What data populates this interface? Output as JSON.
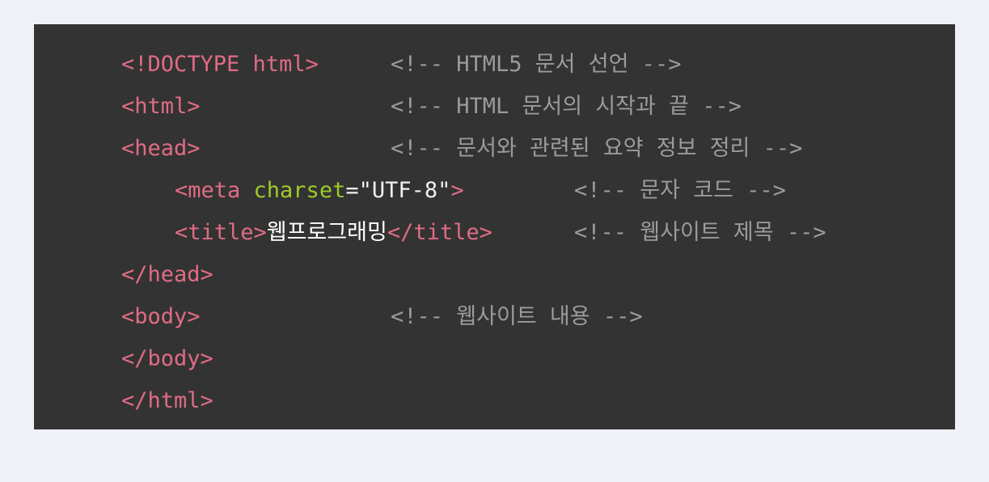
{
  "lines": [
    {
      "code": "<!DOCTYPE html>",
      "comment": "<!-- HTML5 문서 선언 -->"
    },
    {
      "code": "<html>",
      "comment": "<!-- HTML 문서의 시작과 끝 -->"
    },
    {
      "code": "<head>",
      "comment": "<!-- 문서와 관련된 요약 정보 정리 -->"
    },
    {
      "code_tag_open": "<meta",
      "code_attr": " charset",
      "code_eq": "=",
      "code_value": "\"UTF-8\"",
      "code_tag_close": ">",
      "comment": "<!-- 문자 코드 -->"
    },
    {
      "code_tag_open": "<title>",
      "code_text": "웹프로그래밍",
      "code_tag_close": "</title>",
      "comment": "<!-- 웹사이트 제목 -->"
    },
    {
      "code": "</head>"
    },
    {
      "code": "<body>",
      "comment": "<!-- 웹사이트 내용 -->"
    },
    {
      "code": "</body>"
    },
    {
      "code": "</html>"
    }
  ],
  "colors": {
    "page_background": "#eff0f8",
    "panel_background": "#333333",
    "tag": "#e06c84",
    "attribute": "#9ecb27",
    "comment": "#9b9b9b",
    "text": "#ffffff"
  }
}
